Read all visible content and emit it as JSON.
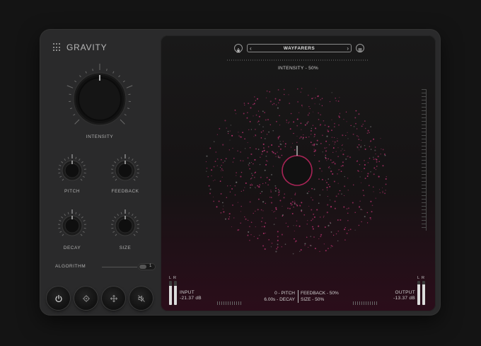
{
  "app": {
    "name": "GRAVITY"
  },
  "knobs": {
    "intensity": {
      "label": "INTENSITY",
      "value": 0.5
    },
    "pitch": {
      "label": "PITCH"
    },
    "feedback": {
      "label": "FEEDBACK"
    },
    "decay": {
      "label": "DECAY"
    },
    "size": {
      "label": "SIZE"
    }
  },
  "algorithm": {
    "label": "ALGORITHM",
    "value": "1"
  },
  "bottom_buttons": [
    {
      "icon": "power-icon"
    },
    {
      "icon": "settings-icon"
    },
    {
      "icon": "move-icon"
    },
    {
      "icon": "speaker-mute-icon"
    }
  ],
  "display": {
    "preset": "WAYFARERS",
    "prev_arrow": "‹",
    "next_arrow": "›",
    "intensity_readout": "INTENSITY - 50%",
    "input": {
      "title": "INPUT",
      "value": "-21.37 dB",
      "lr": "LR"
    },
    "output": {
      "title": "OUTPUT",
      "value": "-13.37 dB",
      "lr": "LR"
    },
    "stats": {
      "pitch": "0 - PITCH",
      "decay": "6.00s - DECAY",
      "feedback": "FEEDBACK - 50%",
      "size": "SIZE - 50%"
    }
  },
  "colors": {
    "particle": "#b0306a",
    "accent": "#e6e6e6"
  }
}
